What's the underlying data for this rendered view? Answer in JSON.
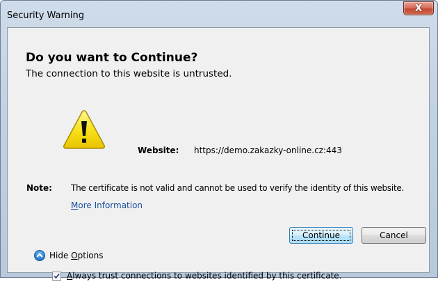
{
  "window": {
    "title": "Security Warning",
    "close_label": "X"
  },
  "dialog": {
    "heading": "Do you want to Continue?",
    "subheading": "The connection to this website is untrusted.",
    "website_label": "Website:",
    "website_value": "https://demo.zakazky-online.cz:443",
    "note_label": "Note:",
    "note_text": "The certificate is not valid and cannot be used to verify the identity of this website.",
    "more_info": {
      "first": "M",
      "rest": "ore Information"
    }
  },
  "buttons": {
    "continue_label": "Continue",
    "cancel_label": "Cancel"
  },
  "options": {
    "hide_options_prefix": "Hide ",
    "hide_options_mnemonic": "O",
    "hide_options_rest": "ptions",
    "always_trust_mnemonic": "A",
    "always_trust_rest": "lways trust connections to websites identified by this certificate.",
    "always_trust_checked": true
  },
  "icons": {
    "close": "close-icon",
    "warning": "warning-icon",
    "hide_options": "chevron-up-icon",
    "checkbox": "checkmark-icon"
  },
  "colors": {
    "link": "#1a4fa0",
    "close_button": "#c24a33",
    "warning_yellow": "#f7e21b"
  }
}
